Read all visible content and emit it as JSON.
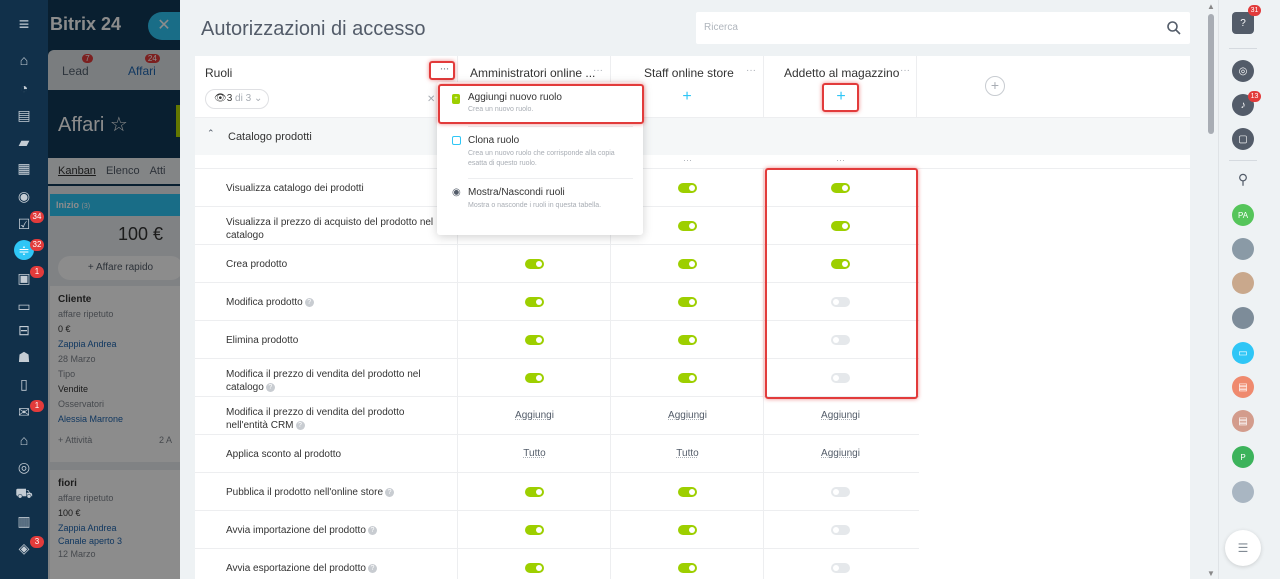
{
  "background": {
    "logo": "Bitrix 24",
    "tabs": [
      {
        "label": "Lead",
        "badge": "7"
      },
      {
        "label": "Affari",
        "badge": "24"
      }
    ],
    "title": "Affari",
    "views": [
      "Kanban",
      "Elenco",
      "Atti"
    ],
    "column": {
      "label": "Inizio",
      "count": "(3)",
      "sum": "100 €",
      "quick_add": "Affare rapido"
    },
    "cards": [
      {
        "title": "Cliente",
        "sub": "affare ripetuto",
        "amount": "0 €",
        "contact": "Zappia Andrea",
        "date": "28 Marzo",
        "type_label": "Tipo",
        "type": "Vendite",
        "obs_label": "Osservatori",
        "observer": "Alessia Marrone",
        "activity": "+ Attività",
        "count": "2 A"
      },
      {
        "title": "fiori",
        "sub": "affare ripetuto",
        "amount": "100 €",
        "contact": "Zappia Andrea",
        "channel": "Canale aperto 3",
        "date": "12 Marzo"
      }
    ],
    "nav_badges": {
      "tasks": "34",
      "crm": "32",
      "calendar": "1",
      "mail": "1",
      "sites": "3"
    }
  },
  "page": {
    "title": "Autorizzazioni di accesso",
    "search_placeholder": "Ricerca"
  },
  "roles": {
    "label": "Ruoli",
    "filter_count": "3",
    "filter_total": "di 3",
    "columns": [
      {
        "name": "Amministratori online ..."
      },
      {
        "name": "Staff online store"
      },
      {
        "name": "Addetto al magazzino"
      }
    ]
  },
  "section": {
    "title": "Catalogo prodotti"
  },
  "permissions": [
    {
      "label": "Visualizza catalogo dei prodotti",
      "help": false,
      "values": [
        "on",
        "on",
        "on"
      ]
    },
    {
      "label": "Visualizza il prezzo di acquisto del prodotto nel catalogo",
      "help": false,
      "values": [
        "on",
        "on",
        "on"
      ]
    },
    {
      "label": "Crea prodotto",
      "help": false,
      "values": [
        "on",
        "on",
        "on"
      ]
    },
    {
      "label": "Modifica prodotto",
      "help": true,
      "values": [
        "on",
        "on",
        "off"
      ]
    },
    {
      "label": "Elimina prodotto",
      "help": false,
      "values": [
        "on",
        "on",
        "off"
      ]
    },
    {
      "label": "Modifica il prezzo di vendita del prodotto nel catalogo",
      "help": true,
      "values": [
        "on",
        "on",
        "off"
      ]
    },
    {
      "label": "Modifica il prezzo di vendita del prodotto nell'entità CRM",
      "help": true,
      "values": [
        "Aggiungi",
        "Aggiungi",
        "Aggiungi"
      ]
    },
    {
      "label": "Applica sconto al prodotto",
      "help": false,
      "values": [
        "Tutto",
        "Tutto",
        "Aggiungi"
      ]
    },
    {
      "label": "Pubblica il prodotto nell'online store",
      "help": true,
      "values": [
        "on",
        "on",
        "off"
      ]
    },
    {
      "label": "Avvia importazione del prodotto",
      "help": true,
      "values": [
        "on",
        "on",
        "off"
      ]
    },
    {
      "label": "Avvia esportazione del prodotto",
      "help": true,
      "values": [
        "on",
        "on",
        "off"
      ]
    }
  ],
  "dropdown": {
    "items": [
      {
        "title": "Aggiungi nuovo ruolo",
        "desc": "Crea un nuovo ruolo.",
        "icon": "new-role-icon"
      },
      {
        "title": "Clona ruolo",
        "desc": "Crea un nuovo ruolo che corrisponde alla copia esatta di questo ruolo.",
        "icon": "clone-icon"
      },
      {
        "title": "Mostra/Nascondi ruoli",
        "desc": "Mostra o nasconde i ruoli in questa tabella.",
        "icon": "eye-icon"
      }
    ]
  },
  "right_bar": {
    "help_badge": "31",
    "notif_badge": "13",
    "avatars": [
      "PA",
      "P"
    ]
  },
  "colors": {
    "accent": "#2fc6f6",
    "toggle_on": "#9dcf00",
    "highlight": "#e23b3b"
  }
}
